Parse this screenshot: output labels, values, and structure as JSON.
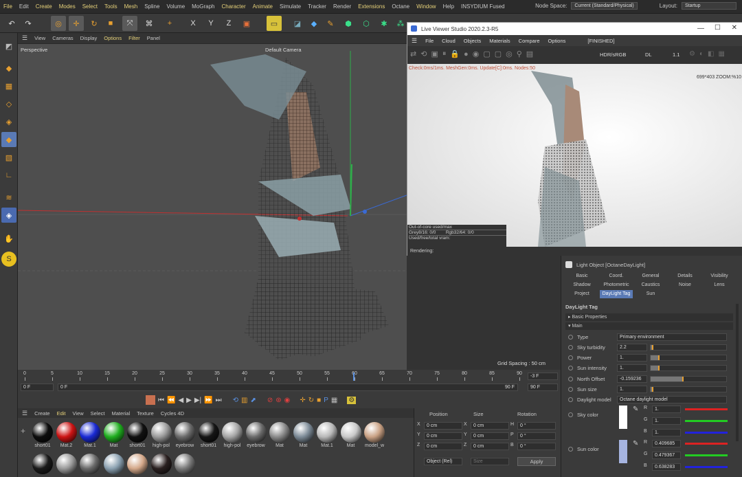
{
  "menu": {
    "items": [
      {
        "label": "File",
        "hl": true
      },
      {
        "label": "Edit",
        "hl": false
      },
      {
        "label": "Create",
        "hl": true
      },
      {
        "label": "Modes",
        "hl": true
      },
      {
        "label": "Select",
        "hl": true
      },
      {
        "label": "Tools",
        "hl": true
      },
      {
        "label": "Mesh",
        "hl": true
      },
      {
        "label": "Spline",
        "hl": false
      },
      {
        "label": "Volume",
        "hl": false
      },
      {
        "label": "MoGraph",
        "hl": false
      },
      {
        "label": "Character",
        "hl": true
      },
      {
        "label": "Animate",
        "hl": true
      },
      {
        "label": "Simulate",
        "hl": false
      },
      {
        "label": "Tracker",
        "hl": false
      },
      {
        "label": "Render",
        "hl": false
      },
      {
        "label": "Extensions",
        "hl": true
      },
      {
        "label": "Octane",
        "hl": false
      },
      {
        "label": "Window",
        "hl": true
      },
      {
        "label": "Help",
        "hl": false
      },
      {
        "label": "INSYDIUM Fused",
        "hl": false
      }
    ],
    "node_space_label": "Node Space:",
    "node_space_value": "Current (Standard/Physical)",
    "layout_label": "Layout:",
    "layout_value": "Startup"
  },
  "viewport": {
    "menu": [
      "View",
      "Cameras",
      "Display",
      "Options",
      "Filter",
      "Panel"
    ],
    "name": "Perspective",
    "camera": "Default Camera",
    "grid_spacing": "Grid Spacing : 50 cm"
  },
  "timeline": {
    "ticks": [
      "0",
      "5",
      "10",
      "15",
      "20",
      "25",
      "30",
      "35",
      "40",
      "45",
      "50",
      "55",
      "60",
      "65",
      "70",
      "75",
      "80",
      "85",
      "90"
    ],
    "current": "-3 F",
    "start": "0 F",
    "start2": "0 F",
    "end": "90 F",
    "end2": "90 F"
  },
  "materials": {
    "menu": [
      "Create",
      "Edit",
      "View",
      "Select",
      "Material",
      "Texture",
      "Cycles 4D"
    ],
    "row1": [
      {
        "name": "short01",
        "color": "#0d0d0d"
      },
      {
        "name": "Mat.2",
        "color": "#cc1414"
      },
      {
        "name": "Mat.1",
        "color": "#1a2ad4"
      },
      {
        "name": "Mat",
        "color": "#1fae1f"
      },
      {
        "name": "short01",
        "color": "#111"
      },
      {
        "name": "high-pol",
        "color": "#9a9a9a"
      },
      {
        "name": "eyebrow",
        "color": "#6a6a6a"
      },
      {
        "name": "short01",
        "color": "#151515"
      },
      {
        "name": "high-pol",
        "color": "#a5a5a5"
      },
      {
        "name": "eyebrow",
        "color": "#6a6a6a"
      },
      {
        "name": "Mat",
        "color": "#8a8a8a"
      },
      {
        "name": "Mat",
        "color": "#7c8a96"
      },
      {
        "name": "Mat.1",
        "color": "#b8b8b8"
      },
      {
        "name": "Mat",
        "color": "#c9c9c9"
      },
      {
        "name": "model_w",
        "color": "#c9a184"
      }
    ],
    "row2": [
      {
        "color": "#1a1a1a"
      },
      {
        "color": "#9a9a9a"
      },
      {
        "color": "#6a6a6a"
      },
      {
        "color": "#8aa0b0"
      },
      {
        "color": "#d4a88a"
      },
      {
        "color": "#2a2020"
      },
      {
        "color": "#7a7a7a"
      }
    ]
  },
  "coords": {
    "headers": [
      "Position",
      "Size",
      "Rotation"
    ],
    "rows": [
      {
        "axis": "X",
        "pos": "0 cm",
        "saxis": "X",
        "size": "0 cm",
        "raxis": "H",
        "rot": "0 °"
      },
      {
        "axis": "Y",
        "pos": "0 cm",
        "saxis": "Y",
        "size": "0 cm",
        "raxis": "P",
        "rot": "0 °"
      },
      {
        "axis": "Z",
        "pos": "0 cm",
        "saxis": "Z",
        "size": "0 cm",
        "raxis": "B",
        "rot": "0 °"
      }
    ],
    "mode": "Object (Rel)",
    "size_mode": "Size",
    "apply": "Apply"
  },
  "liveviewer": {
    "title": "Live Viewer Studio 2020.2.3-R5",
    "menu": [
      "File",
      "Cloud",
      "Objects",
      "Materials",
      "Compare",
      "Options"
    ],
    "state": "[FINISHED]",
    "color_mode": "HDR/sRGB",
    "dl": "DL",
    "zoom_val": "1.1",
    "stats": "Check:0ms/1ms. MeshGen:0ms. Update[C]:0ms. Nodes:50",
    "zoom": "699*403 ZOOM:%10",
    "overlay1": "Out-of-core used/max",
    "overlay2": "Grey8/16: 0/0",
    "overlay2b": "Rgb32/64: 0/0",
    "overlay3": "Used/free/total vram:",
    "status": "Rendering:"
  },
  "attributes": {
    "header": "Light Object [OctaneDayLight]",
    "tabs_row1": [
      "Basic",
      "Coord.",
      "General",
      "Details",
      "Visibility"
    ],
    "tabs_row2": [
      "Shadow",
      "Photometric",
      "Caustics",
      "Noise",
      "Lens"
    ],
    "tabs_row3": [
      "Project",
      "DayLight Tag",
      "Sun"
    ],
    "section": "DayLight Tag",
    "group1": "Basic Properties",
    "group2": "Main",
    "props": [
      {
        "label": "Type",
        "value": "Primary environment",
        "kind": "dropdown"
      },
      {
        "label": "Sky turbidity",
        "value": "2.2",
        "fill": 0.02
      },
      {
        "label": "Power",
        "value": "1.",
        "fill": 0.1
      },
      {
        "label": "Sun intensity",
        "value": "1.",
        "fill": 0.1
      },
      {
        "label": "North Offset",
        "value": "-0.159236",
        "fill": 0.42
      },
      {
        "label": "Sun size",
        "value": "1.",
        "fill": 0.02
      },
      {
        "label": "Daylight model",
        "value": "Octane daylight model",
        "kind": "dropdown"
      }
    ],
    "sky_color": {
      "label": "Sky color",
      "swatch": "#ffffff",
      "R": "1.",
      "G": "1.",
      "B": "1."
    },
    "sun_color": {
      "label": "Sun color",
      "swatch": "#a6b4e0",
      "R": "0.409685",
      "G": "0.479367",
      "B": "0.638283"
    }
  }
}
